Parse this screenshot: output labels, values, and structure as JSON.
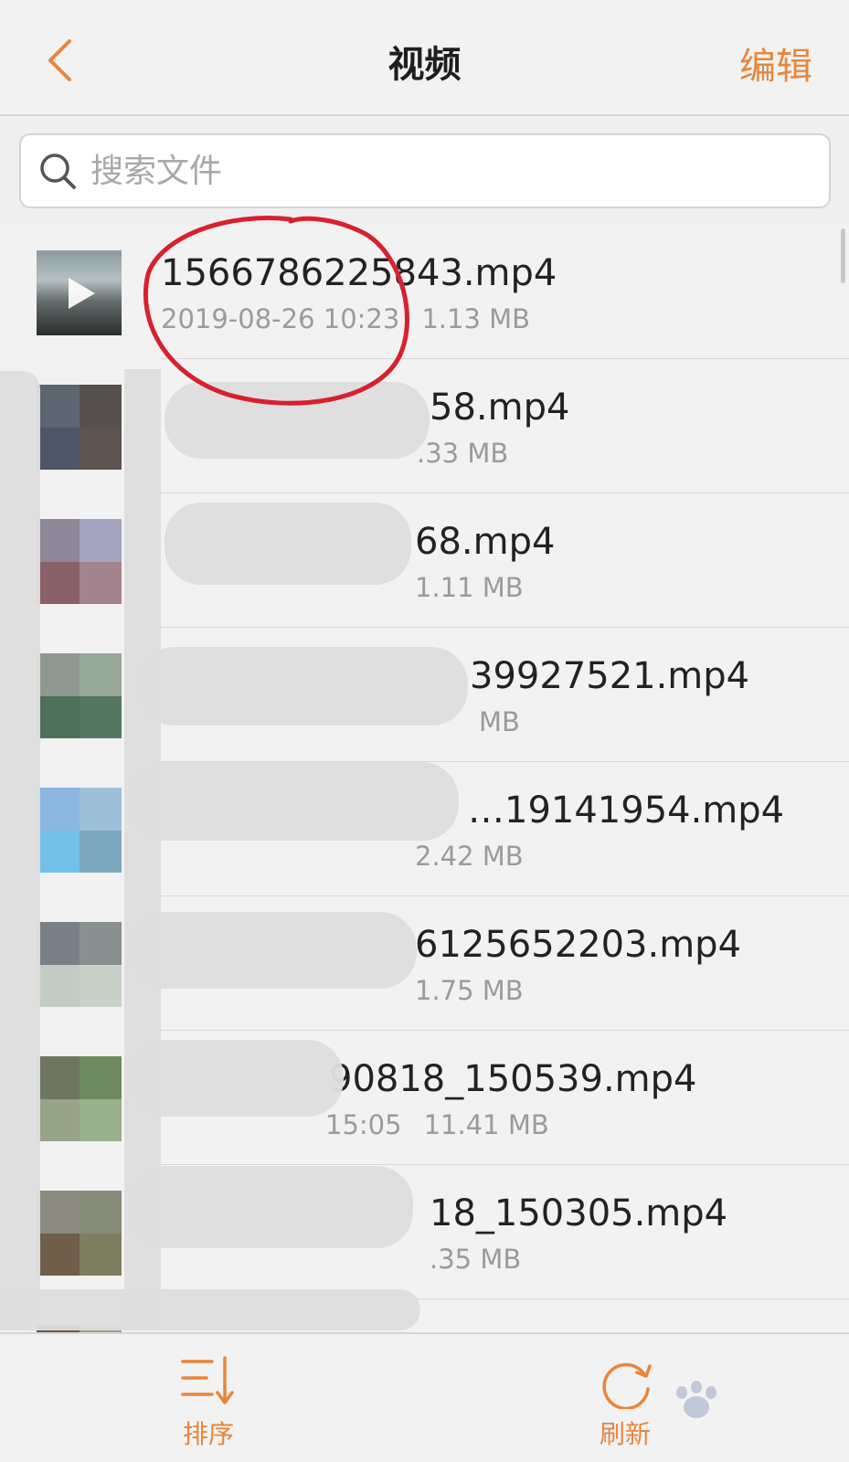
{
  "header": {
    "back_icon": "chevron-left-icon",
    "title": "视频",
    "edit_label": "编辑"
  },
  "search": {
    "placeholder": "搜索文件",
    "icon": "search-icon"
  },
  "files": [
    {
      "name": "1566786225843.mp4",
      "date": "2019-08-26 10:23",
      "size": "1.13 MB"
    },
    {
      "name": "58.mp4",
      "date": "",
      "size": ".33 MB"
    },
    {
      "name": "68.mp4",
      "date": "",
      "size": "1.11 MB"
    },
    {
      "name": "39927521.mp4",
      "date": "",
      "size": "MB"
    },
    {
      "name": "…19141954.mp4",
      "date": "",
      "size": "2.42 MB"
    },
    {
      "name": "6125652203.mp4",
      "date": "",
      "size": "1.75 MB"
    },
    {
      "name": "90818_150539.mp4",
      "date": "15:05",
      "size": "11.41 MB"
    },
    {
      "name": "18_150305.mp4",
      "date": "",
      "size": ".35 MB"
    }
  ],
  "tabbar": {
    "sort_label": "排序",
    "sort_icon": "sort-icon",
    "refresh_label": "刷新",
    "refresh_icon": "refresh-icon"
  },
  "colors": {
    "accent": "#e9853a",
    "annotation": "#d8202e"
  }
}
